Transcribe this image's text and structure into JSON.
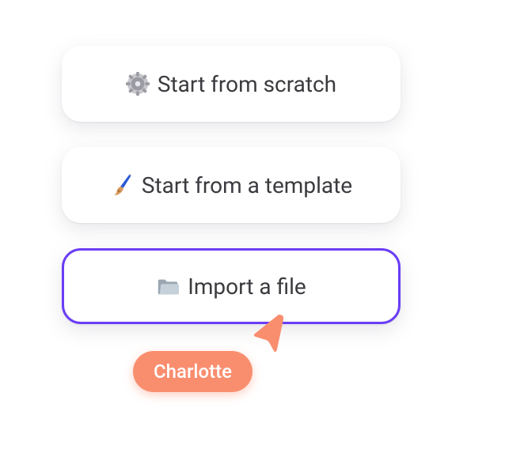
{
  "options": [
    {
      "label": "Start from scratch",
      "icon": "gear-icon",
      "selected": false
    },
    {
      "label": "Start from a template",
      "icon": "brush-icon",
      "selected": false
    },
    {
      "label": "Import a file",
      "icon": "folder-icon",
      "selected": true
    }
  ],
  "collaborator": {
    "name": "Charlotte",
    "color": "#f98e6f"
  },
  "accent": "#6a3df5"
}
